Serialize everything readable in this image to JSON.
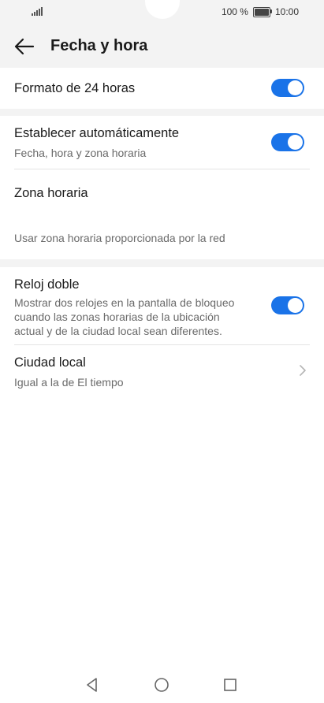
{
  "status_bar": {
    "battery_text": "100 %",
    "time": "10:00",
    "icons": [
      "signal-icon",
      "battery-icon"
    ]
  },
  "header": {
    "title": "Fecha y hora",
    "back_icon": "arrow-left-icon"
  },
  "settings": {
    "format24": {
      "title": "Formato de 24 horas",
      "enabled": true
    },
    "auto": {
      "title": "Establecer automáticamente",
      "subtitle": "Fecha, hora y zona horaria",
      "enabled": true
    },
    "timezone": {
      "title": "Zona horaria",
      "subtitle": "Usar zona horaria proporcionada por la red"
    },
    "dual_clock": {
      "title": "Reloj doble",
      "subtitle_line1": "Mostrar dos relojes en la pantalla de bloqueo",
      "subtitle_line2": "cuando las zonas horarias de la ubicación",
      "subtitle_line3": "actual y de la ciudad local sean diferentes.",
      "enabled": true
    },
    "local_city": {
      "title": "Ciudad local",
      "subtitle": "Igual a la de El tiempo",
      "icon": "chevron-right-icon"
    }
  },
  "colors": {
    "accent": "#1a73e8",
    "background": "#f3f3f3",
    "card": "#ffffff"
  },
  "navbar": {
    "icons": [
      "back-triangle-icon",
      "home-circle-icon",
      "recents-square-icon"
    ]
  }
}
